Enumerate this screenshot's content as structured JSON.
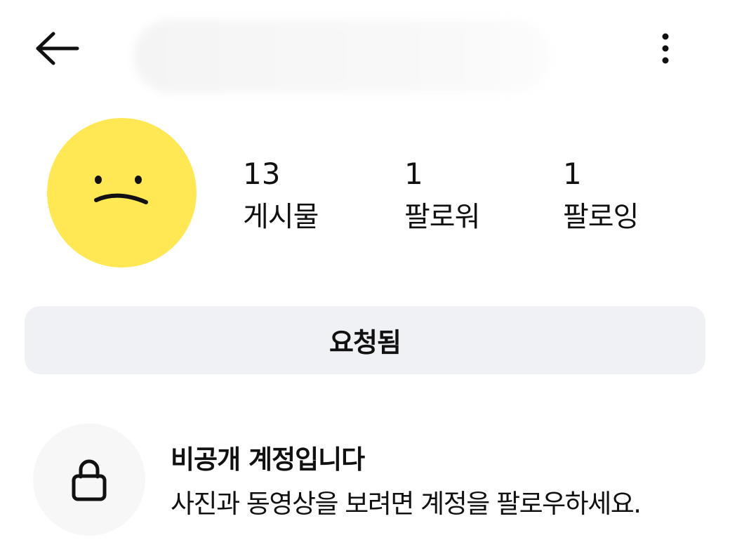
{
  "header": {
    "back_icon": "arrow-left-icon",
    "more_icon": "more-vertical-icon"
  },
  "profile": {
    "avatar_icon": "sad-face-icon",
    "avatar_color": "#FFE853",
    "stats": [
      {
        "value": "13",
        "label": "게시물"
      },
      {
        "value": "1",
        "label": "팔로워"
      },
      {
        "value": "1",
        "label": "팔로잉"
      }
    ]
  },
  "actions": {
    "requested_label": "요청됨"
  },
  "private_notice": {
    "icon": "lock-icon",
    "title": "비공개 계정입니다",
    "description": "사진과 동영상을 보려면 계정을 팔로우하세요."
  }
}
